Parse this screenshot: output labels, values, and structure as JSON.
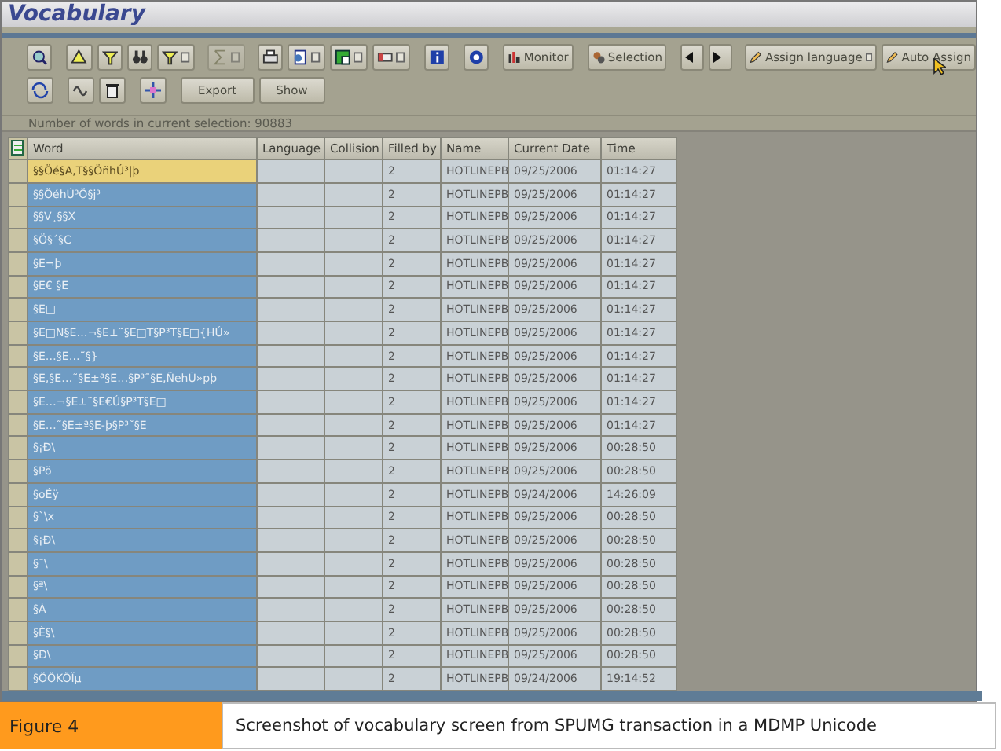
{
  "window": {
    "title": "Vocabulary"
  },
  "toolbar": {
    "buttons": [
      {
        "label": "Monitor"
      },
      {
        "label": "Selection"
      },
      {
        "label": "Assign language"
      },
      {
        "label": "Auto Assign"
      }
    ],
    "second_row_buttons": [
      {
        "label": "Export"
      },
      {
        "label": "Show"
      }
    ]
  },
  "status": "Number of words in current selection: 90883",
  "table": {
    "columns": [
      "Word",
      "Language",
      "Collision",
      "Filled by",
      "Name",
      "Current Date",
      "Time"
    ],
    "rows": [
      {
        "word": "§§Öé§A,T§§ÖñhÚ³|þ",
        "language": "",
        "collision": "",
        "filled_by": "2",
        "name": "HOTLINEPB",
        "date": "09/25/2006",
        "time": "01:14:27",
        "selected": true
      },
      {
        "word": "§§ÖéhÚ³Ö§j³",
        "filled_by": "2",
        "name": "HOTLINEPB",
        "date": "09/25/2006",
        "time": "01:14:27",
        "selected": false
      },
      {
        "word": "§§V¸§§X",
        "filled_by": "2",
        "name": "HOTLINEPB",
        "date": "09/25/2006",
        "time": "01:14:27",
        "selected": false
      },
      {
        "word": "§Ö§´§C",
        "filled_by": "2",
        "name": "HOTLINEPB",
        "date": "09/25/2006",
        "time": "01:14:27",
        "selected": false
      },
      {
        "word": "§E¬þ",
        "filled_by": "2",
        "name": "HOTLINEPB",
        "date": "09/25/2006",
        "time": "01:14:27",
        "selected": false
      },
      {
        "word": "§E€ §E",
        "filled_by": "2",
        "name": "HOTLINEPB",
        "date": "09/25/2006",
        "time": "01:14:27",
        "selected": false
      },
      {
        "word": "§E□",
        "filled_by": "2",
        "name": "HOTLINEPB",
        "date": "09/25/2006",
        "time": "01:14:27",
        "selected": false
      },
      {
        "word": "§E□N§E…¬§E±˜§E□T§P³T§E□{HÚ»",
        "filled_by": "2",
        "name": "HOTLINEPB",
        "date": "09/25/2006",
        "time": "01:14:27",
        "selected": false
      },
      {
        "word": "§E…§E…˜§}",
        "filled_by": "2",
        "name": "HOTLINEPB",
        "date": "09/25/2006",
        "time": "01:14:27",
        "selected": false
      },
      {
        "word": "§E‚§E…˜§E±ª§E…§P³˜§E‚ÑehÚ»pþ",
        "filled_by": "2",
        "name": "HOTLINEPB",
        "date": "09/25/2006",
        "time": "01:14:27",
        "selected": false
      },
      {
        "word": "§E…¬§E±˜§E€Ú§P³T§E□",
        "filled_by": "2",
        "name": "HOTLINEPB",
        "date": "09/25/2006",
        "time": "01:14:27",
        "selected": false
      },
      {
        "word": "§E…˜§E±ª§E-þ§P³˜§E",
        "filled_by": "2",
        "name": "HOTLINEPB",
        "date": "09/25/2006",
        "time": "01:14:27",
        "selected": false
      },
      {
        "word": "§¡Ð\\",
        "filled_by": "2",
        "name": "HOTLINEPB",
        "date": "09/25/2006",
        "time": "00:28:50",
        "selected": false
      },
      {
        "word": "§Pö",
        "filled_by": "2",
        "name": "HOTLINEPB",
        "date": "09/25/2006",
        "time": "00:28:50",
        "selected": false
      },
      {
        "word": "§oÉÿ",
        "filled_by": "2",
        "name": "HOTLINEPB",
        "date": "09/24/2006",
        "time": "14:26:09",
        "selected": false
      },
      {
        "word": "§`\\x",
        "filled_by": "2",
        "name": "HOTLINEPB",
        "date": "09/25/2006",
        "time": "00:28:50",
        "selected": false
      },
      {
        "word": "§¡Ð\\",
        "filled_by": "2",
        "name": "HOTLINEPB",
        "date": "09/25/2006",
        "time": "00:28:50",
        "selected": false
      },
      {
        "word": "§¯\\",
        "filled_by": "2",
        "name": "HOTLINEPB",
        "date": "09/25/2006",
        "time": "00:28:50",
        "selected": false
      },
      {
        "word": "§ª\\",
        "filled_by": "2",
        "name": "HOTLINEPB",
        "date": "09/25/2006",
        "time": "00:28:50",
        "selected": false
      },
      {
        "word": "§Á",
        "filled_by": "2",
        "name": "HOTLINEPB",
        "date": "09/25/2006",
        "time": "00:28:50",
        "selected": false
      },
      {
        "word": "§È§\\",
        "filled_by": "2",
        "name": "HOTLINEPB",
        "date": "09/25/2006",
        "time": "00:28:50",
        "selected": false
      },
      {
        "word": "§Ð\\",
        "filled_by": "2",
        "name": "HOTLINEPB",
        "date": "09/25/2006",
        "time": "00:28:50",
        "selected": false
      },
      {
        "word": "§ÖÖKÖÏµ",
        "filled_by": "2",
        "name": "HOTLINEPB",
        "date": "09/24/2006",
        "time": "19:14:52",
        "selected": false
      }
    ]
  },
  "caption": {
    "label": "Figure 4",
    "text": "Screenshot of vocabulary screen from SPUMG transaction in a MDMP Unicode"
  }
}
